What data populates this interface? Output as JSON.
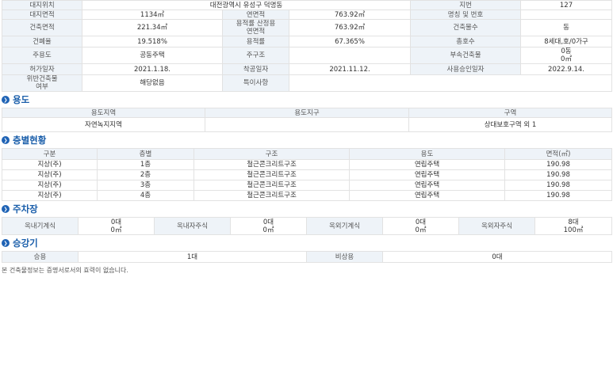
{
  "basic": {
    "rows": [
      [
        {
          "t": "대지위치",
          "h": 1
        },
        {
          "t": "대전광역시 유성구 덕명동",
          "cs": 3
        },
        {
          "t": "지번",
          "h": 1
        },
        {
          "t": "127"
        }
      ],
      [
        {
          "t": "대지면적",
          "h": 1
        },
        {
          "t": "1134㎡"
        },
        {
          "t": "연면적",
          "h": 1
        },
        {
          "t": "763.92㎡"
        },
        {
          "t": "명칭 및 번호",
          "h": 1
        },
        {
          "t": ""
        }
      ],
      [
        {
          "t": "건축면적",
          "h": 1
        },
        {
          "t": "221.34㎡"
        },
        {
          "t": "용적률 산정용\n연면적",
          "h": 1
        },
        {
          "t": "763.92㎡"
        },
        {
          "t": "건축물수",
          "h": 1
        },
        {
          "t": "동"
        }
      ],
      [
        {
          "t": "건폐율",
          "h": 1
        },
        {
          "t": "19.518%"
        },
        {
          "t": "용적률",
          "h": 1
        },
        {
          "t": "67.365%"
        },
        {
          "t": "총호수",
          "h": 1
        },
        {
          "t": "8세대,호/0가구"
        }
      ],
      [
        {
          "t": "주용도",
          "h": 1
        },
        {
          "t": "공동주택"
        },
        {
          "t": "주구조",
          "h": 1
        },
        {
          "t": ""
        },
        {
          "t": "부속건축물",
          "h": 1
        },
        {
          "t": "0동\n0㎡"
        }
      ],
      [
        {
          "t": "허가일자",
          "h": 1
        },
        {
          "t": "2021.1.18."
        },
        {
          "t": "착공일자",
          "h": 1
        },
        {
          "t": "2021.11.12."
        },
        {
          "t": "사용승인일자",
          "h": 1
        },
        {
          "t": "2022.9.14."
        }
      ],
      [
        {
          "t": "위반건축물\n여부",
          "h": 1
        },
        {
          "t": "해당없음"
        },
        {
          "t": "특이사항",
          "h": 1
        },
        {
          "t": "",
          "cs": 3
        }
      ]
    ]
  },
  "usage": {
    "title": "용도",
    "headers": [
      "용도지역",
      "용도지구",
      "구역"
    ],
    "values": [
      "자연녹지지역",
      "",
      "상대보호구역 외 1"
    ]
  },
  "floors": {
    "title": "층별현황",
    "headers": [
      "구분",
      "층별",
      "구조",
      "용도",
      "면적(㎡)"
    ],
    "rows": [
      [
        "지상(주)",
        "1층",
        "철근콘크리트구조",
        "연립주택",
        "190.98"
      ],
      [
        "지상(주)",
        "2층",
        "철근콘크리트구조",
        "연립주택",
        "190.98"
      ],
      [
        "지상(주)",
        "3층",
        "철근콘크리트구조",
        "연립주택",
        "190.98"
      ],
      [
        "지상(주)",
        "4층",
        "철근콘크리트구조",
        "연립주택",
        "190.98"
      ]
    ]
  },
  "parking": {
    "title": "주차장",
    "cells": [
      {
        "label": "옥내기계식",
        "value": "0대\n0㎡"
      },
      {
        "label": "옥내자주식",
        "value": "0대\n0㎡"
      },
      {
        "label": "옥외기계식",
        "value": "0대\n0㎡"
      },
      {
        "label": "옥외자주식",
        "value": "8대\n100㎡"
      }
    ]
  },
  "elevator": {
    "title": "승강기",
    "passenger_label": "승용",
    "passenger_value": "1대",
    "emergency_label": "비상용",
    "emergency_value": "0대"
  },
  "footer": "본 건축물정보는 증명서로서의 효력이 없습니다.",
  "icon_char": "❯"
}
